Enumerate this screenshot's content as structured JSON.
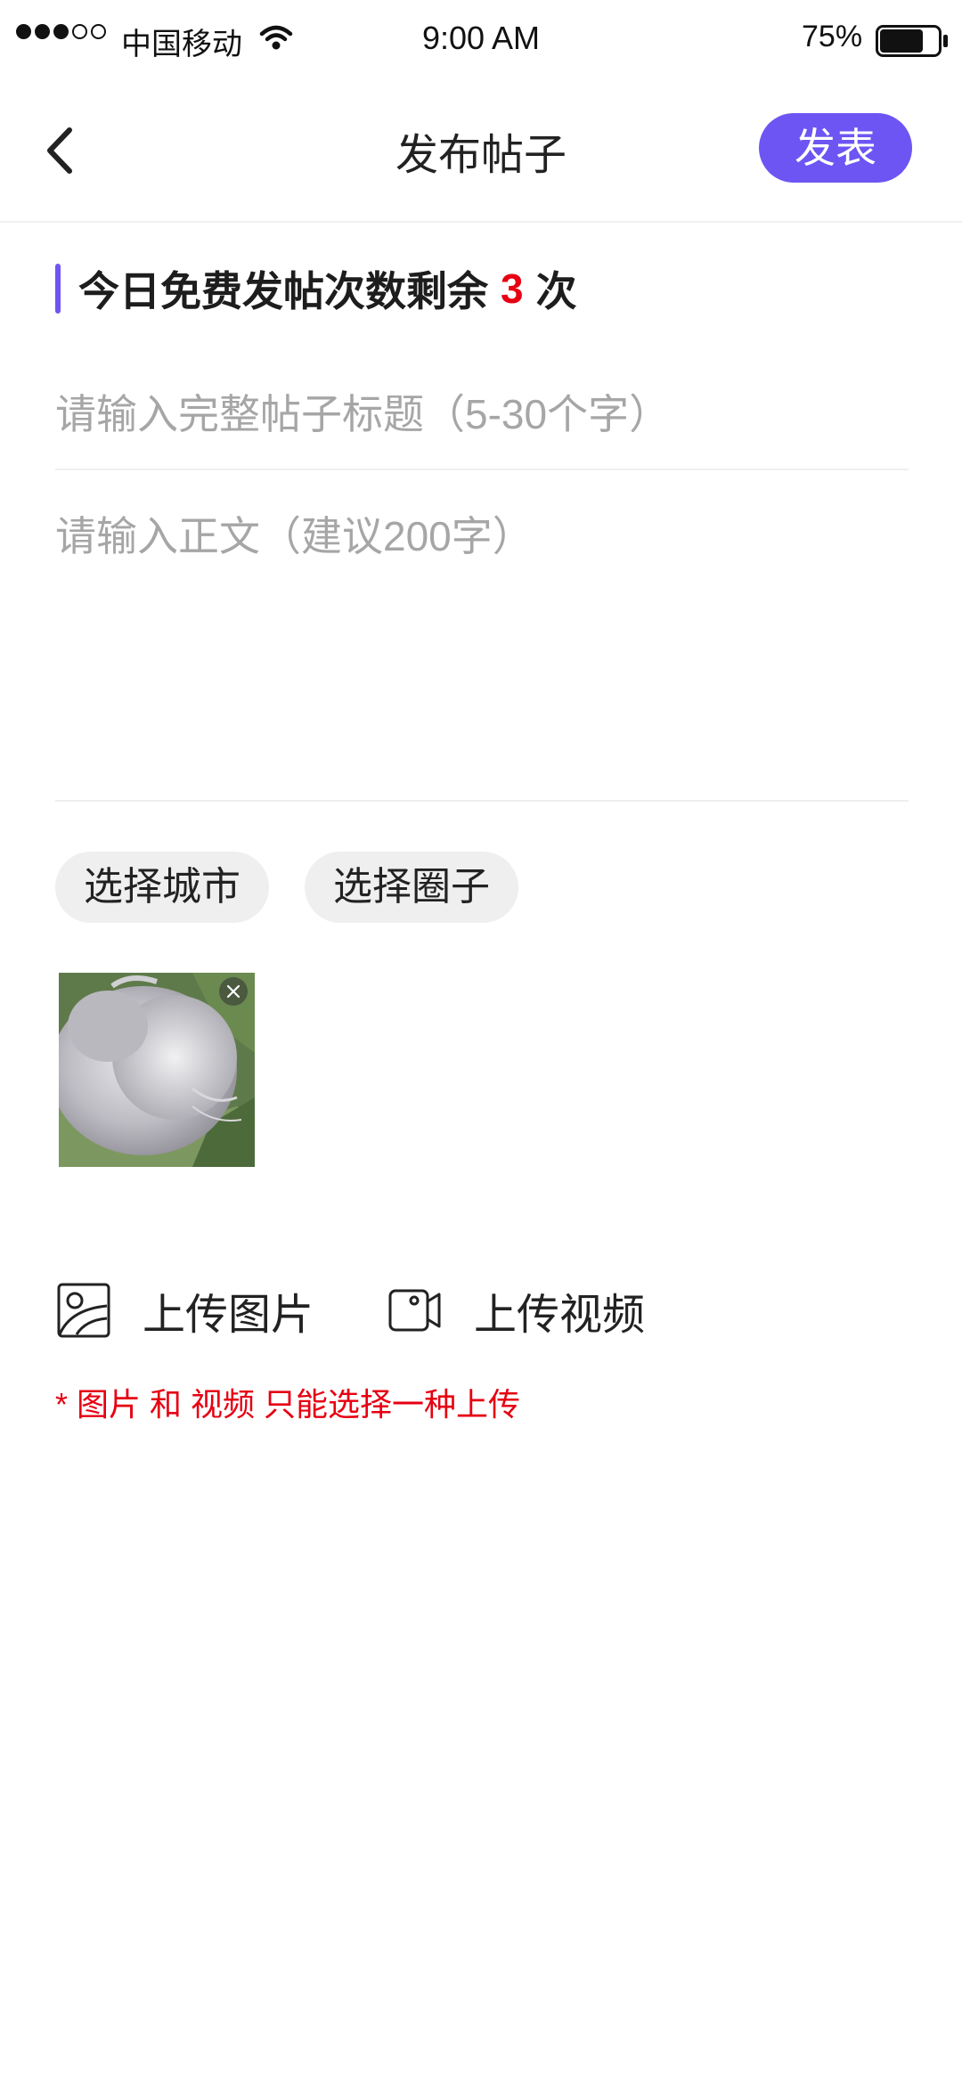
{
  "status_bar": {
    "carrier": "中国移动",
    "time": "9:00 AM",
    "battery_percent": "75%",
    "battery_level": 0.75,
    "signal_bars": 3,
    "signal_total": 5
  },
  "nav": {
    "back_icon": "chevron-left-icon",
    "title": "发布帖子",
    "publish_label": "发表",
    "accent_color": "#6d55f3"
  },
  "quota": {
    "prefix": "今日免费发帖次数剩余",
    "count": "3",
    "suffix": "次",
    "count_color": "#e60012"
  },
  "form": {
    "title_placeholder": "请输入完整帖子标题（5-30个字）",
    "title_value": "",
    "body_placeholder": "请输入正文（建议200字）",
    "body_value": ""
  },
  "chips": {
    "city_label": "选择城市",
    "circle_label": "选择圈子"
  },
  "media": {
    "thumbnail_icon": "cat-photo",
    "remove_icon": "close-icon"
  },
  "upload": {
    "image_label": "上传图片",
    "image_icon": "image-icon",
    "video_label": "上传视频",
    "video_icon": "video-camera-icon",
    "note": "* 图片 和 视频 只能选择一种上传",
    "note_color": "#e60012"
  }
}
